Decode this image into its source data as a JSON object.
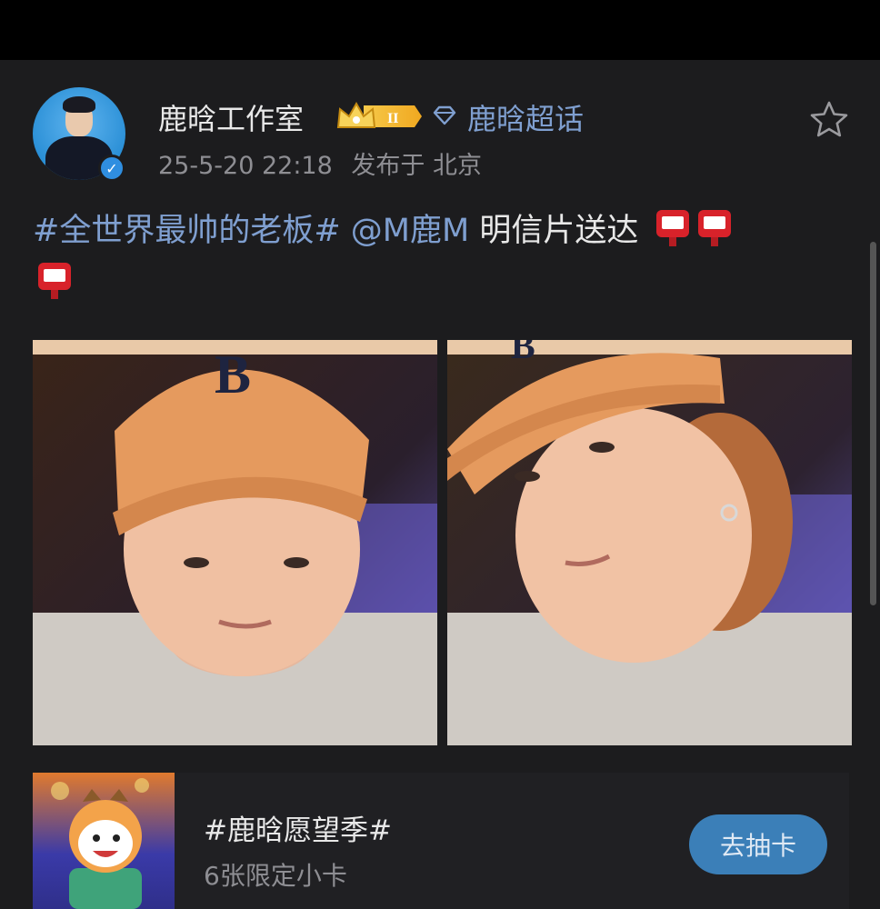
{
  "post": {
    "username": "鹿晗工作室",
    "level_badge": "II",
    "supertopic": "鹿晗超话",
    "timestamp": "25-5-20 22:18",
    "location": "发布于 北京",
    "hashtag": "#全世界最帅的老板#",
    "mention": "@M鹿M",
    "text": "明信片送达",
    "photos": [
      "photo-1",
      "photo-2"
    ]
  },
  "promo": {
    "title": "#鹿晗愿望季#",
    "subtitle": "6张限定小卡",
    "button": "去抽卡"
  },
  "colors": {
    "background": "#1c1c1e",
    "link": "#7f9fd0",
    "verified": "#2f8ee0",
    "button": "#3b7fb8"
  },
  "icons": [
    "verified-icon",
    "crown-icon",
    "diamond-icon",
    "star-icon",
    "mailbox-emoji"
  ]
}
